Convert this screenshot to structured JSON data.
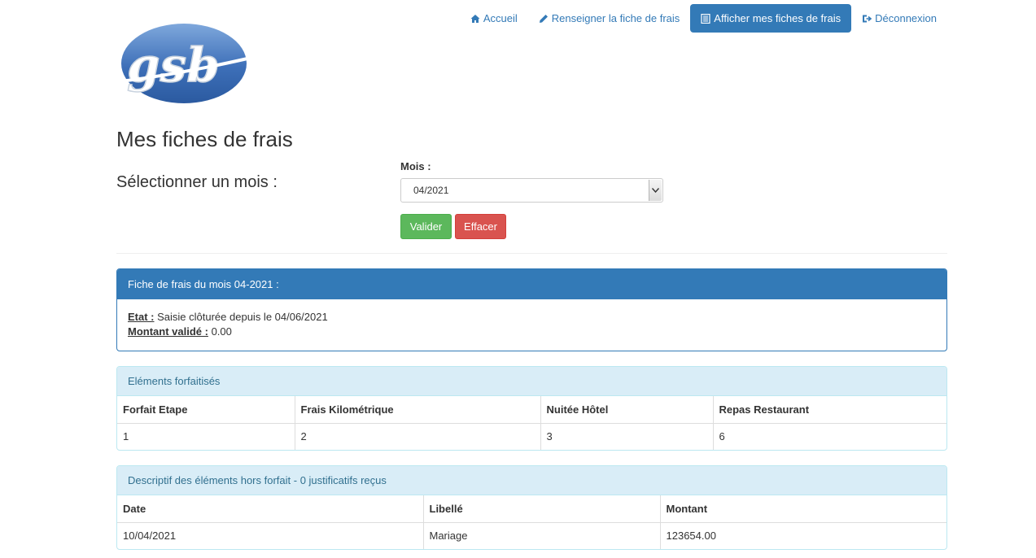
{
  "nav": {
    "items": [
      {
        "label": "Accueil",
        "icon": "home-icon"
      },
      {
        "label": "Renseigner la fiche de frais",
        "icon": "pencil-icon"
      },
      {
        "label": "Afficher mes fiches de frais",
        "icon": "list-icon",
        "active": true
      },
      {
        "label": "Déconnexion",
        "icon": "logout-icon"
      }
    ]
  },
  "logo": {
    "text": "gsb"
  },
  "page": {
    "title": "Mes fiches de frais",
    "select_title": "Sélectionner un mois :"
  },
  "form": {
    "mois_label": "Mois :",
    "mois_value": "04/2021",
    "valider": "Valider",
    "effacer": "Effacer"
  },
  "fiche": {
    "heading": "Fiche de frais du mois 04-2021 :",
    "etat_label": "Etat :",
    "etat_value": "Saisie clôturée depuis le 04/06/2021",
    "montant_label": "Montant validé :",
    "montant_value": "0.00"
  },
  "forfait": {
    "heading": "Eléments forfaitisés",
    "columns": [
      "Forfait Etape",
      "Frais Kilométrique",
      "Nuitée Hôtel",
      "Repas Restaurant"
    ],
    "values": [
      "1",
      "2",
      "3",
      "6"
    ]
  },
  "hors_forfait": {
    "heading": "Descriptif des éléments hors forfait - 0 justificatifs reçus",
    "columns": [
      "Date",
      "Libellé",
      "Montant"
    ],
    "rows": [
      [
        "10/04/2021",
        "Mariage",
        "123654.00"
      ]
    ]
  },
  "colors": {
    "primary": "#337ab7",
    "success": "#5cb85c",
    "danger": "#d9534f",
    "info_bg": "#d9edf7",
    "info_text": "#31708f"
  }
}
